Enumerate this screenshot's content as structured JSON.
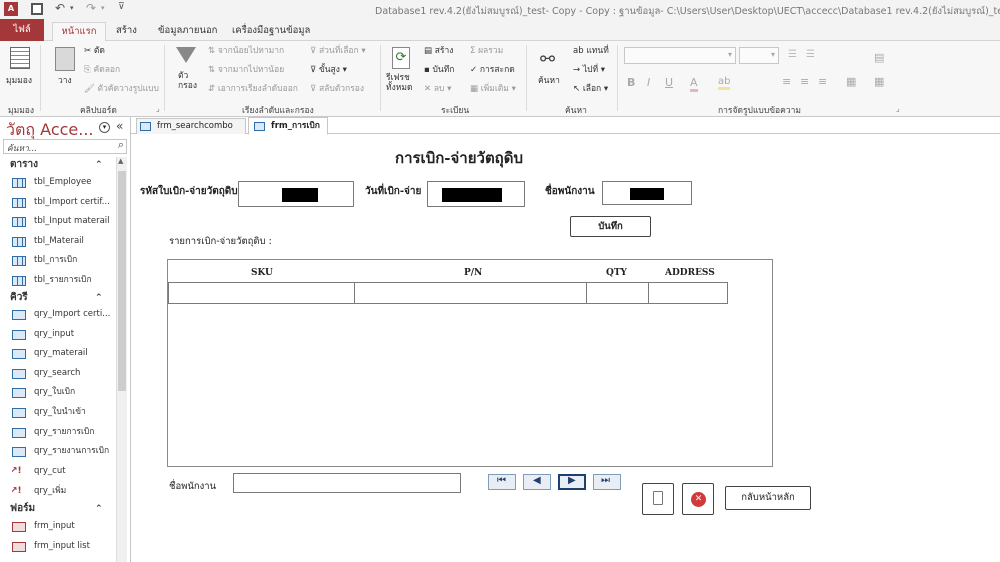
{
  "titlebar": {
    "title": "Database1 rev.4.2(ยังไม่สมบูรณ์)_test- Copy - Copy : ฐานข้อมูล- C:\\Users\\User\\Desktop\\UECT\\accecc\\Database1 rev.4.2(ยังไม่สมบูรณ์)_test- Copy - Copy"
  },
  "tabs": {
    "file": "ไฟล์",
    "home": "หน้าแรก",
    "create": "สร้าง",
    "external": "ข้อมูลภายนอก",
    "dbtools": "เครื่องมือฐานข้อมูล"
  },
  "ribbon": {
    "view_label": "มุมมอง",
    "view_group": "มุมมอง",
    "paste": "วาง",
    "cut": "ตัด",
    "copy": "คัดลอก",
    "format_painter": "ตัวคัดวางรูปแบบ",
    "clipboard_group": "คลิปบอร์ด",
    "filter": "ตัว\nกรอง",
    "ascending": "จากน้อยไปหามาก",
    "descending": "จากมากไปหาน้อย",
    "remove_sort": "เอาการเรียงลำดับออก",
    "selection": "ส่วนที่เลือก",
    "advanced": "ขั้นสูง",
    "toggle_filter": "สลับตัวกรอง",
    "sort_group": "เรียงลำดับและกรอง",
    "refresh": "รีเฟรช\nทั้งหมด",
    "new": "สร้าง",
    "save": "บันทึก",
    "delete": "ลบ",
    "totals": "ผลรวม",
    "spelling": "การสะกด",
    "more": "เพิ่มเติม",
    "records_group": "ระเบียน",
    "find": "ค้นหา",
    "replace": "แทนที่",
    "goto": "ไปที่",
    "select": "เลือก",
    "find_group": "ค้นหา",
    "format_group": "การจัดรูปแบบข้อความ"
  },
  "nav": {
    "title": "วัตถุ Acce...",
    "search_placeholder": "ค้นหา...",
    "tables_header": "ตาราง",
    "tables": [
      "tbl_Employee",
      "tbl_Import certif...",
      "tbl_Input materail",
      "tbl_Materail",
      "tbl_การเบิก",
      "tbl_รายการเบิก"
    ],
    "queries_header": "คิวรี",
    "queries": [
      "qry_Import certi...",
      "qry_input",
      "qry_materail",
      "qry_search",
      "qry_ใบเบิก",
      "qry_ใบนำเข้า",
      "qry_รายการเบิก",
      "qry_รายงานการเบิก"
    ],
    "action_queries": [
      "qry_cut",
      "qry_เพิ่ม"
    ],
    "forms_header": "ฟอร์ม",
    "forms": [
      "frm_input",
      "frm_input list"
    ]
  },
  "doc_tabs": {
    "tab1": "frm_searchcombo",
    "tab2": "frm_การเบิก"
  },
  "form": {
    "title": "การเบิก-จ่ายวัตถุดิบ",
    "code_label": "รหัสใบเบิก-จ่ายวัตถุดิบ",
    "date_label": "วันที่เบิก-จ่าย",
    "employee_label": "ชื่อพนักงาน",
    "save_button": "บันทึก",
    "list_label": "รายการเบิก-จ่ายวัตถุดิบ :",
    "columns": [
      "SKU",
      "P/N",
      "QTY",
      "ADDRESS"
    ],
    "employee_field_label": "ชื่อพนักงาน",
    "back_button": "กลับหน้าหลัก"
  }
}
